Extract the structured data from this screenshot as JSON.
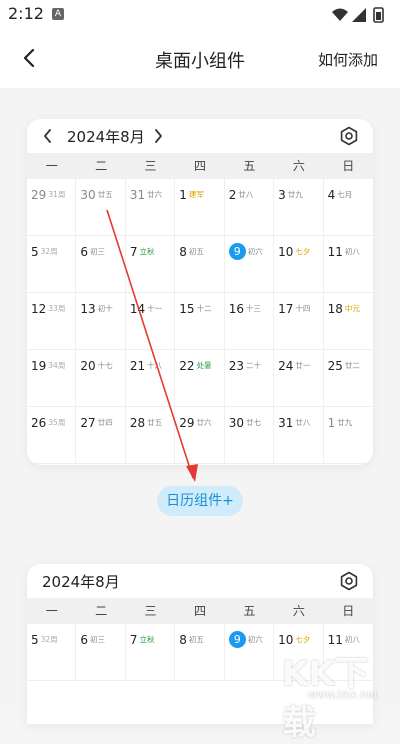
{
  "status_bar": {
    "time": "2:12",
    "app_badge": "A"
  },
  "navbar": {
    "title": "桌面小组件",
    "action": "如何添加"
  },
  "widget1": {
    "title": "2024年8月",
    "weekdays": [
      "一",
      "二",
      "三",
      "四",
      "五",
      "六",
      "日"
    ],
    "rows": [
      [
        {
          "d": "29",
          "s": "31周",
          "dim": true,
          "type": "wk"
        },
        {
          "d": "30",
          "s": "廿五",
          "dim": true
        },
        {
          "d": "31",
          "s": "廿六",
          "dim": true
        },
        {
          "d": "1",
          "s": "建军",
          "type": "fest"
        },
        {
          "d": "2",
          "s": "廿八"
        },
        {
          "d": "3",
          "s": "廿九"
        },
        {
          "d": "4",
          "s": "七月"
        }
      ],
      [
        {
          "d": "5",
          "s": "32周",
          "type": "wk"
        },
        {
          "d": "6",
          "s": "初三"
        },
        {
          "d": "7",
          "s": "立秋",
          "type": "hol"
        },
        {
          "d": "8",
          "s": "初五"
        },
        {
          "d": "9",
          "s": "初六",
          "today": true
        },
        {
          "d": "10",
          "s": "七夕",
          "type": "fest"
        },
        {
          "d": "11",
          "s": "初八"
        }
      ],
      [
        {
          "d": "12",
          "s": "33周",
          "type": "wk"
        },
        {
          "d": "13",
          "s": "初十"
        },
        {
          "d": "14",
          "s": "十一"
        },
        {
          "d": "15",
          "s": "十二"
        },
        {
          "d": "16",
          "s": "十三"
        },
        {
          "d": "17",
          "s": "十四"
        },
        {
          "d": "18",
          "s": "中元",
          "type": "fest"
        }
      ],
      [
        {
          "d": "19",
          "s": "34周",
          "type": "wk"
        },
        {
          "d": "20",
          "s": "十七"
        },
        {
          "d": "21",
          "s": "十八"
        },
        {
          "d": "22",
          "s": "处暑",
          "type": "hol"
        },
        {
          "d": "23",
          "s": "二十"
        },
        {
          "d": "24",
          "s": "廿一"
        },
        {
          "d": "25",
          "s": "廿二"
        }
      ],
      [
        {
          "d": "26",
          "s": "35周",
          "type": "wk"
        },
        {
          "d": "27",
          "s": "廿四"
        },
        {
          "d": "28",
          "s": "廿五"
        },
        {
          "d": "29",
          "s": "廿六"
        },
        {
          "d": "30",
          "s": "廿七"
        },
        {
          "d": "31",
          "s": "廿八"
        },
        {
          "d": "1",
          "s": "廿九",
          "dim": true
        }
      ]
    ]
  },
  "add_widget_label": "日历组件+",
  "widget2": {
    "title": "2024年8月",
    "weekdays": [
      "一",
      "二",
      "三",
      "四",
      "五",
      "六",
      "日"
    ],
    "rows": [
      [
        {
          "d": "5",
          "s": "32周",
          "type": "wk"
        },
        {
          "d": "6",
          "s": "初三"
        },
        {
          "d": "7",
          "s": "立秋",
          "type": "hol"
        },
        {
          "d": "8",
          "s": "初五"
        },
        {
          "d": "9",
          "s": "初六",
          "today": true
        },
        {
          "d": "10",
          "s": "七夕",
          "type": "fest"
        },
        {
          "d": "11",
          "s": "初八"
        }
      ]
    ]
  },
  "watermark": {
    "main": "KK下载",
    "sub": "www.kkx.net"
  },
  "colors": {
    "accent": "#1a9bf0",
    "solar_term": "#2f9e44",
    "festival": "#e0a100",
    "arrow": "#e53935"
  }
}
